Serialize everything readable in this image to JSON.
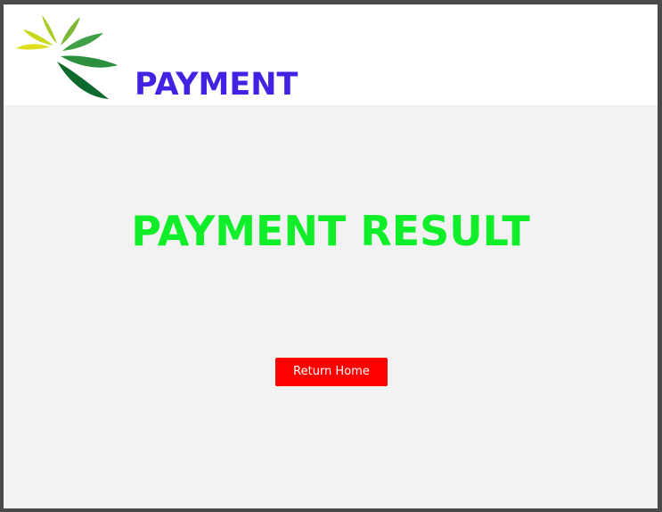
{
  "header": {
    "logo_icon": "leaf-fan-logo-icon",
    "title": "PAYMENT"
  },
  "main": {
    "result_title": "PAYMENT RESULT",
    "return_button_label": "Return Home"
  },
  "colors": {
    "brand_title": "#4422e4",
    "result_title": "#10ee2a",
    "button_bg": "#ff0000",
    "header_bg": "#ffffff",
    "page_bg": "#f2f2f2",
    "frame": "#4a4a4a"
  }
}
